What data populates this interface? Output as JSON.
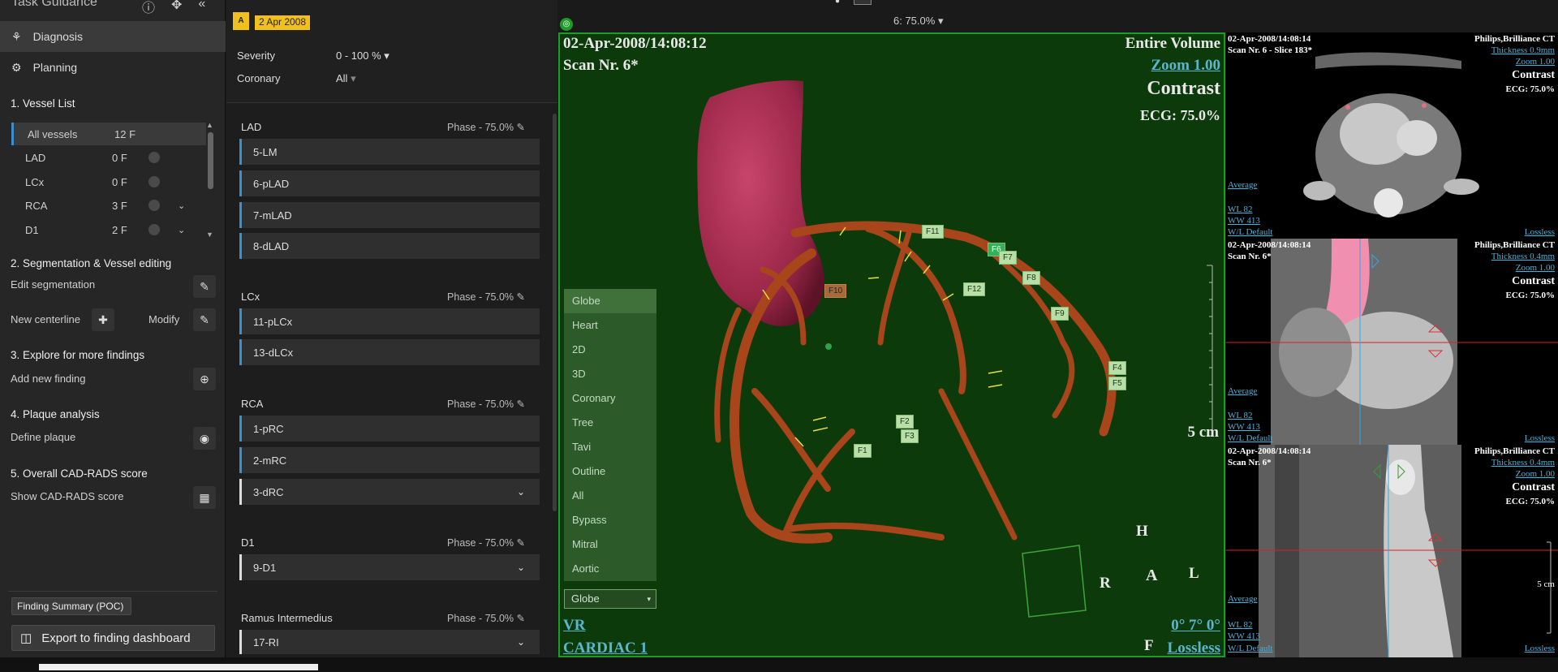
{
  "left": {
    "title": "Task Guidance",
    "nav": [
      {
        "label": "Diagnosis"
      },
      {
        "label": "Planning"
      }
    ],
    "vessel_list_title": "1.  Vessel List",
    "vessels": [
      {
        "name": "All vessels",
        "count": "12 F"
      },
      {
        "name": "LAD",
        "count": "0 F"
      },
      {
        "name": "LCx",
        "count": "0 F"
      },
      {
        "name": "RCA",
        "count": "3 F"
      },
      {
        "name": "D1",
        "count": "2 F"
      }
    ],
    "sec2": "2.  Segmentation & Vessel editing",
    "edit_seg": "Edit segmentation",
    "new_centerline": "New centerline",
    "modify": "Modify",
    "sec3": "3.  Explore for more findings",
    "add_finding": "Add new finding",
    "sec4": "4.  Plaque analysis",
    "define_plaque": "Define plaque",
    "sec5": "5.  Overall CAD-RADS score",
    "show_cadrads": "Show CAD-RADS score",
    "finding_summary": "Finding Summary (POC)",
    "export": "Export to finding dashboard"
  },
  "mid": {
    "date_badge": "2 Apr 2008",
    "star_badge": "A",
    "severity_label": "Severity",
    "severity_value": "0 - 100 %",
    "coronary_label": "Coronary",
    "coronary_value": "All",
    "groups": [
      {
        "name": "LAD",
        "phase": "Phase - 75.0%",
        "segments": [
          "5-LM",
          "6-pLAD",
          "7-mLAD",
          "8-dLAD"
        ]
      },
      {
        "name": "LCx",
        "phase": "Phase - 75.0%",
        "segments": [
          "11-pLCx",
          "13-dLCx"
        ]
      },
      {
        "name": "RCA",
        "phase": "Phase - 75.0%",
        "segments": [
          "1-pRC",
          "2-mRC",
          "3-dRC"
        ]
      },
      {
        "name": "D1",
        "phase": "Phase - 75.0%",
        "segments": [
          "9-D1"
        ]
      },
      {
        "name": "Ramus Intermedius",
        "phase": "Phase - 75.0%",
        "segments": [
          "17-RI"
        ]
      }
    ]
  },
  "top": {
    "phase_select": "6: 75.0%"
  },
  "viewport": {
    "date": "02-Apr-2008/14:08:12",
    "scan": "Scan Nr. 6*",
    "volume": "Entire Volume",
    "zoom": "Zoom 1.00",
    "contrast": "Contrast",
    "ecg": "ECG: 75.0%",
    "scale": "5 cm",
    "mode": "VR",
    "protocol": "CARDIAC 1",
    "angle": "0° 7° 0°",
    "lossless": "Lossless",
    "orient": {
      "h": "H",
      "r": "R",
      "l": "L",
      "f": "F",
      "a": "A"
    },
    "menu": [
      "Globe",
      "Heart",
      "2D",
      "3D",
      "Coronary",
      "Tree",
      "Tavi",
      "Outline",
      "All",
      "Bypass",
      "Mitral",
      "Aortic"
    ],
    "menu_selected": "Globe",
    "flags": [
      "F11",
      "F6",
      "F7",
      "F8",
      "F12",
      "F9",
      "F10",
      "F4",
      "F5",
      "F2",
      "F3",
      "F1"
    ]
  },
  "right": [
    {
      "date": "02-Apr-2008/14:08:14",
      "scan": "Scan Nr. 6 - Slice 183*",
      "vendor": "Philips,Brilliance CT",
      "thickness": "Thickness 0.9mm",
      "zoom": "Zoom 1.00",
      "contrast": "Contrast",
      "ecg": "ECG: 75.0%",
      "avg": "Average",
      "wl": "WL     82",
      "ww": "WW    413",
      "wld": "W/L Default",
      "lossless": "Lossless"
    },
    {
      "date": "02-Apr-2008/14:08:14",
      "scan": "Scan Nr. 6*",
      "vendor": "Philips,Brilliance CT",
      "thickness": "Thickness 0.4mm",
      "zoom": "Zoom 1.00",
      "contrast": "Contrast",
      "ecg": "ECG: 75.0%",
      "avg": "Average",
      "wl": "WL     82",
      "ww": "WW    413",
      "wld": "W/L Default",
      "lossless": "Lossless"
    },
    {
      "date": "02-Apr-2008/14:08:14",
      "scan": "Scan Nr. 6*",
      "vendor": "Philips,Brilliance CT",
      "thickness": "Thickness 0.4mm",
      "zoom": "Zoom 1.00",
      "contrast": "Contrast",
      "ecg": "ECG: 75.0%",
      "avg": "Average",
      "wl": "WL     82",
      "ww": "WW    413",
      "wld": "W/L Default",
      "lossless": "Lossless",
      "scale": "5 cm"
    }
  ]
}
